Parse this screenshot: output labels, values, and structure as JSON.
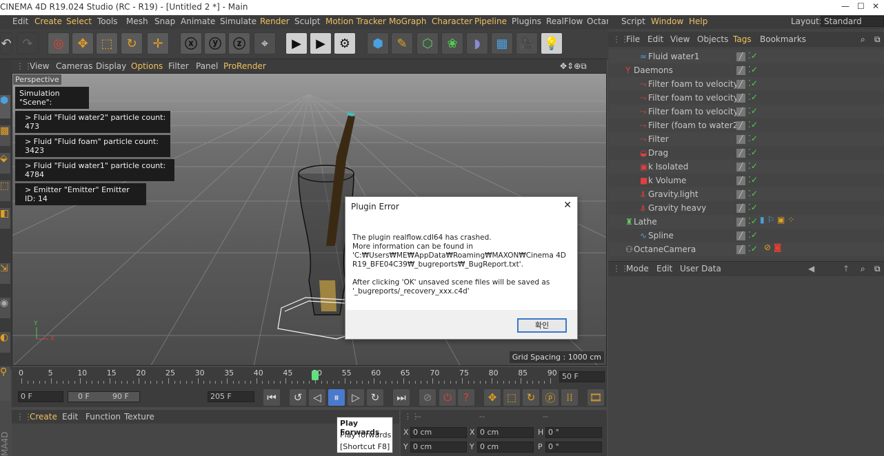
{
  "window": {
    "title": "CINEMA 4D R19.024 Studio (RC - R19) - [Untitled 2 *] - Main",
    "layout_label": "Layout:",
    "layout_value": "Standard"
  },
  "menu": [
    "Edit",
    "Create",
    "Select",
    "Tools",
    "Mesh",
    "Snap",
    "Animate",
    "Simulate",
    "Render",
    "Sculpt",
    "Motion Tracker",
    "MoGraph",
    "Character",
    "Pipeline",
    "Plugins",
    "RealFlow",
    "Octane",
    "Script",
    "Window",
    "Help"
  ],
  "viewport_menu": [
    "View",
    "Cameras",
    "Display",
    "Options",
    "Filter",
    "Panel",
    "ProRender"
  ],
  "viewport": {
    "label": "Perspective",
    "grid_spacing": "Grid Spacing : 1000 cm",
    "axis_y": "Y",
    "axis_x": "X"
  },
  "simulation": {
    "title": "Simulation \"Scene\":",
    "lines": [
      "> Fluid \"Fluid water2\" particle count: 473",
      "> Fluid \"Fluid foam\" particle count: 3423",
      "> Fluid \"Fluid water1\" particle count: 4784",
      "> Emitter \"Emitter\" Emitter ID: 14"
    ]
  },
  "timeline": {
    "ticks": [
      "0",
      "5",
      "10",
      "15",
      "20",
      "25",
      "30",
      "35",
      "40",
      "45",
      "50",
      "55",
      "60",
      "65",
      "70",
      "75",
      "80",
      "85",
      "90"
    ],
    "end_frame": "50 F",
    "current_frame": "50"
  },
  "transport": {
    "start": "0 F",
    "range_start": "0 F",
    "range_end": "90 F",
    "end": "205 F"
  },
  "material_menu": [
    "Create",
    "Edit",
    "Function",
    "Texture"
  ],
  "coords": {
    "header": "--",
    "x1": "X",
    "x1v": "0 cm",
    "x2": "X",
    "x2v": "0 cm",
    "h": "H",
    "hv": "0 °",
    "y1": "Y",
    "y1v": "0 cm",
    "y2": "Y",
    "y2v": "0 cm",
    "p": "P",
    "pv": "0 °"
  },
  "object_menu": [
    "File",
    "Edit",
    "View",
    "Objects",
    "Tags",
    "Bookmarks"
  ],
  "objects": [
    {
      "name": "Fluid water1",
      "indent": 1,
      "icon": "≈",
      "color": "#50a0e0"
    },
    {
      "name": "Daemons",
      "indent": 0,
      "icon": "Y",
      "color": "#e04040"
    },
    {
      "name": "Filter foam to velocity.z",
      "indent": 1,
      "icon": "⤳",
      "color": "#e04040"
    },
    {
      "name": "Filter foam to velocity.x",
      "indent": 1,
      "icon": "⤳",
      "color": "#e04040"
    },
    {
      "name": "Filter foam to velocity Y",
      "indent": 1,
      "icon": "⤳",
      "color": "#e04040"
    },
    {
      "name": "Filter (foam to water2",
      "indent": 1,
      "icon": "⤳",
      "color": "#e04040"
    },
    {
      "name": "Filter",
      "indent": 1,
      "icon": "⤳",
      "color": "#e04040"
    },
    {
      "name": "Drag",
      "indent": 1,
      "icon": "◒",
      "color": "#e04040"
    },
    {
      "name": "k Isolated",
      "indent": 1,
      "icon": "▣",
      "color": "#e04040"
    },
    {
      "name": "k Volume",
      "indent": 1,
      "icon": "■",
      "color": "#e04040"
    },
    {
      "name": "Gravity.light",
      "indent": 1,
      "icon": "⥥",
      "color": "#e04040"
    },
    {
      "name": "Gravity heavy",
      "indent": 1,
      "icon": "⥥",
      "color": "#e04040"
    },
    {
      "name": "Lathe",
      "indent": 0,
      "icon": "♜",
      "color": "#60d060"
    },
    {
      "name": "Spline",
      "indent": 1,
      "icon": "∿",
      "color": "#50a0e0"
    },
    {
      "name": "OctaneCamera",
      "indent": 0,
      "icon": "⚇",
      "color": "#c0c0c0"
    }
  ],
  "attr_menu": [
    "Mode",
    "Edit",
    "User Data"
  ],
  "dialog": {
    "title": "Plugin Error",
    "close": "✕",
    "lines": [
      "The plugin realflow.cdl64 has crashed.",
      "More information can be found in",
      "'C:₩Users₩ME₩AppData₩Roaming₩MAXON₩Cinema 4D",
      "R19_BFE04C39₩_bugreports₩_BugReport.txt'.",
      "After clicking 'OK' unsaved scene files will be saved as",
      "'_bugreports/_recovery_xxx.c4d'"
    ],
    "ok": "확인"
  },
  "tooltip": {
    "title": "Play Forwards",
    "desc": "Play forwards",
    "shortcut": "[Shortcut F8]"
  },
  "side_label": "MA4D",
  "colors": {
    "accent": "#e6a020",
    "menu_highlight": "#f0c060",
    "check_green": "#50d050"
  }
}
